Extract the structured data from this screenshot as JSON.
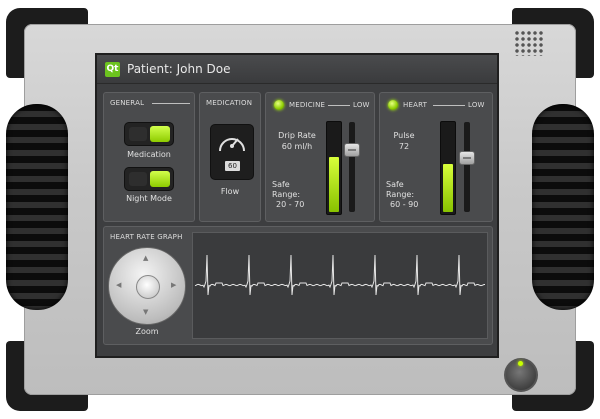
{
  "app": {
    "title": "Patient: John Doe",
    "logo_text": "Qt"
  },
  "general": {
    "header": "GENERAL",
    "toggles": [
      {
        "label": "Medication",
        "on": true
      },
      {
        "label": "Night Mode",
        "on": true
      }
    ]
  },
  "medication": {
    "header": "MEDICATION",
    "gauge_value": "60",
    "gauge_label": "Flow"
  },
  "medicine": {
    "header": "MEDICINE",
    "status": "LOW",
    "rate_label": "Drip Rate",
    "rate_value": "60 ml/h",
    "range_label_1": "Safe",
    "range_label_2": "Range:",
    "range_value": "20 - 70",
    "level_fraction": 0.62,
    "slider_fraction": 0.72
  },
  "heart": {
    "header": "HEART",
    "status": "LOW",
    "pulse_label": "Pulse",
    "pulse_value": "72",
    "range_label_1": "Safe",
    "range_label_2": "Range:",
    "range_value": "60 - 90",
    "level_fraction": 0.55,
    "slider_fraction": 0.62
  },
  "graph": {
    "header": "HEART RATE GRAPH",
    "zoom_label": "Zoom"
  },
  "colors": {
    "accent": "#9bd400",
    "screen_bg": "#3d3e40",
    "panel_bg": "#4a4b4d"
  },
  "icons": [
    "qt-logo",
    "gauge-icon",
    "zoom-pad-icon",
    "speaker-grille",
    "power-button"
  ]
}
